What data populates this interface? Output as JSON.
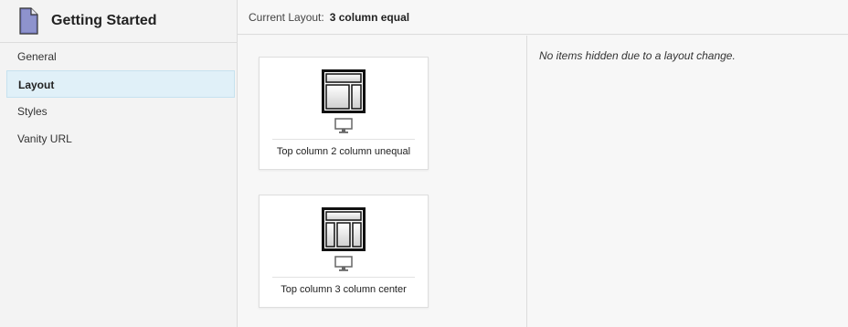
{
  "sidebar": {
    "title": "Getting Started",
    "items": [
      {
        "label": "General"
      },
      {
        "label": "Layout"
      },
      {
        "label": "Styles"
      },
      {
        "label": "Vanity URL"
      }
    ]
  },
  "topbar": {
    "current_layout_label": "Current Layout:",
    "current_layout_value": "3 column equal"
  },
  "layouts": [
    {
      "label": "Top column 2 column unequal",
      "icon": "layout-top-2col-unequal-icon"
    },
    {
      "label": "Top column 3 column center",
      "icon": "layout-top-3col-center-icon"
    }
  ],
  "notice": "No items hidden due to a layout change."
}
